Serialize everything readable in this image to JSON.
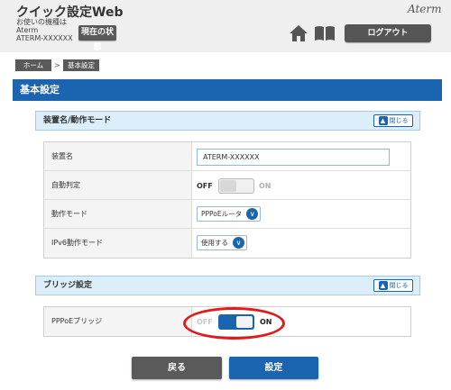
{
  "header": {
    "title": "クイック設定Web",
    "model_label": "お使いの機種は",
    "model_brand": "Aterm",
    "model_name": "ATERM-XXXXXX",
    "status_button": "現在の状態",
    "brand_logo": "Aterm",
    "home_icon": "home-icon",
    "manual_icon": "book-icon",
    "logout_button": "ログアウト"
  },
  "breadcrumb": {
    "items": [
      "ホーム",
      "基本設定"
    ],
    "separator": ">"
  },
  "page_title": "基本設定",
  "sections": [
    {
      "title": "装置名/動作モード",
      "collapse_label": "閉じる",
      "rows": [
        {
          "label": "装置名",
          "type": "text",
          "value": "ATERM-XXXXXX"
        },
        {
          "label": "自動判定",
          "type": "toggle",
          "off_label": "OFF",
          "on_label": "ON",
          "state": "OFF"
        },
        {
          "label": "動作モード",
          "type": "select",
          "value": "PPPoEルータ"
        },
        {
          "label": "IPv6動作モード",
          "type": "select",
          "value": "使用する"
        }
      ]
    },
    {
      "title": "ブリッジ設定",
      "collapse_label": "閉じる",
      "rows": [
        {
          "label": "PPPoEブリッジ",
          "type": "toggle",
          "off_label": "OFF",
          "on_label": "ON",
          "state": "ON"
        }
      ]
    }
  ],
  "footer": {
    "back_button": "戻る",
    "save_button": "設定"
  },
  "colors": {
    "accent": "#1a64b0",
    "section_bg": "#dbeefa",
    "highlight": "#e01b1b"
  }
}
